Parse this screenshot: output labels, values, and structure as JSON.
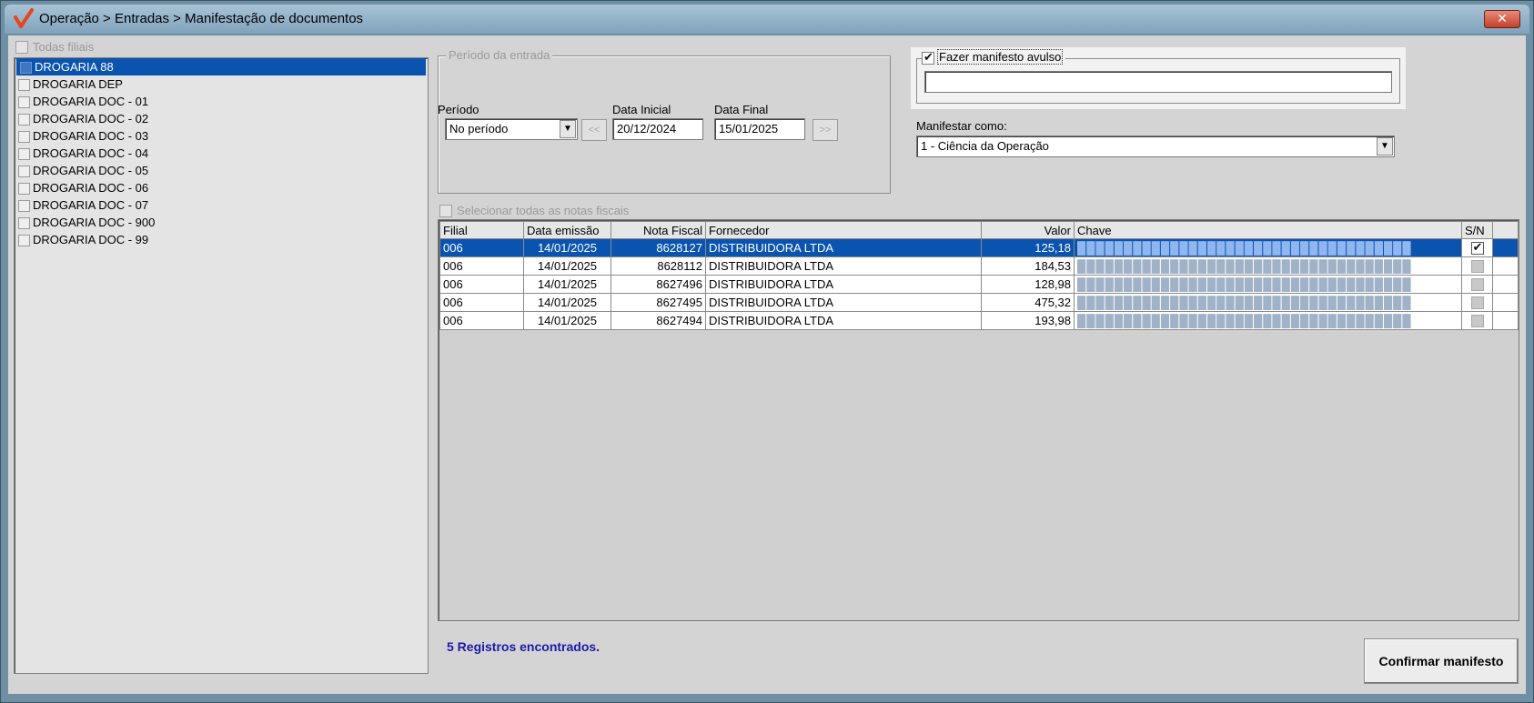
{
  "window": {
    "title": "Operação > Entradas > Manifestação de documentos",
    "close_label": "✕"
  },
  "filiais": {
    "all_label": "Todas filiais",
    "items": [
      {
        "label": "DROGARIA 88",
        "selected": true
      },
      {
        "label": "DROGARIA DEP",
        "selected": false
      },
      {
        "label": "DROGARIA DOC - 01",
        "selected": false
      },
      {
        "label": "DROGARIA DOC - 02",
        "selected": false
      },
      {
        "label": "DROGARIA DOC - 03",
        "selected": false
      },
      {
        "label": "DROGARIA DOC - 04",
        "selected": false
      },
      {
        "label": "DROGARIA DOC - 05",
        "selected": false
      },
      {
        "label": "DROGARIA DOC - 06",
        "selected": false
      },
      {
        "label": "DROGARIA DOC - 07",
        "selected": false
      },
      {
        "label": "DROGARIA DOC - 900",
        "selected": false
      },
      {
        "label": "DROGARIA DOC - 99",
        "selected": false
      }
    ]
  },
  "periodo": {
    "group_title": "Período da entrada",
    "periodo_label": "Período",
    "periodo_value": "No período",
    "prev_label": "<<",
    "next_label": ">>",
    "data_inicial_label": "Data Inicial",
    "data_inicial_value": "20/12/2024",
    "data_final_label": "Data Final",
    "data_final_value": "15/01/2025"
  },
  "avulso": {
    "checkbox_label": "Fazer manifesto avulso",
    "checked": true,
    "input_value": ""
  },
  "manifestar": {
    "label": "Manifestar como:",
    "value": "1 - Ciência da Operação"
  },
  "grid": {
    "select_all_label": "Selecionar todas as notas fiscais",
    "columns": [
      "Filial",
      "Data emissão",
      "Nota Fiscal",
      "Fornecedor",
      "Valor",
      "Chave",
      "S/N"
    ],
    "rows": [
      {
        "filial": "006",
        "data": "14/01/2025",
        "nota": "8628127",
        "fornecedor": "DISTRIBUIDORA  LTDA",
        "valor": "125,18",
        "chave": "████████████████████████████████████",
        "sn": true,
        "selected": true
      },
      {
        "filial": "006",
        "data": "14/01/2025",
        "nota": "8628112",
        "fornecedor": "DISTRIBUIDORA  LTDA",
        "valor": "184,53",
        "chave": "████████████████████████████████████",
        "sn": false,
        "selected": false
      },
      {
        "filial": "006",
        "data": "14/01/2025",
        "nota": "8627496",
        "fornecedor": "DISTRIBUIDORA  LTDA",
        "valor": "128,98",
        "chave": "████████████████████████████████████",
        "sn": false,
        "selected": false
      },
      {
        "filial": "006",
        "data": "14/01/2025",
        "nota": "8627495",
        "fornecedor": "DISTRIBUIDORA  LTDA",
        "valor": "475,32",
        "chave": "████████████████████████████████████",
        "sn": false,
        "selected": false
      },
      {
        "filial": "006",
        "data": "14/01/2025",
        "nota": "8627494",
        "fornecedor": "DISTRIBUIDORA  LTDA",
        "valor": "193,98",
        "chave": "████████████████████████████████████",
        "sn": false,
        "selected": false
      }
    ]
  },
  "status_text": "5 Registros encontrados.",
  "confirm_label": "Confirmar manifesto",
  "colors": {
    "selection": "#0a54b0",
    "status": "#1a1aa8",
    "brand": "#e8431c"
  }
}
